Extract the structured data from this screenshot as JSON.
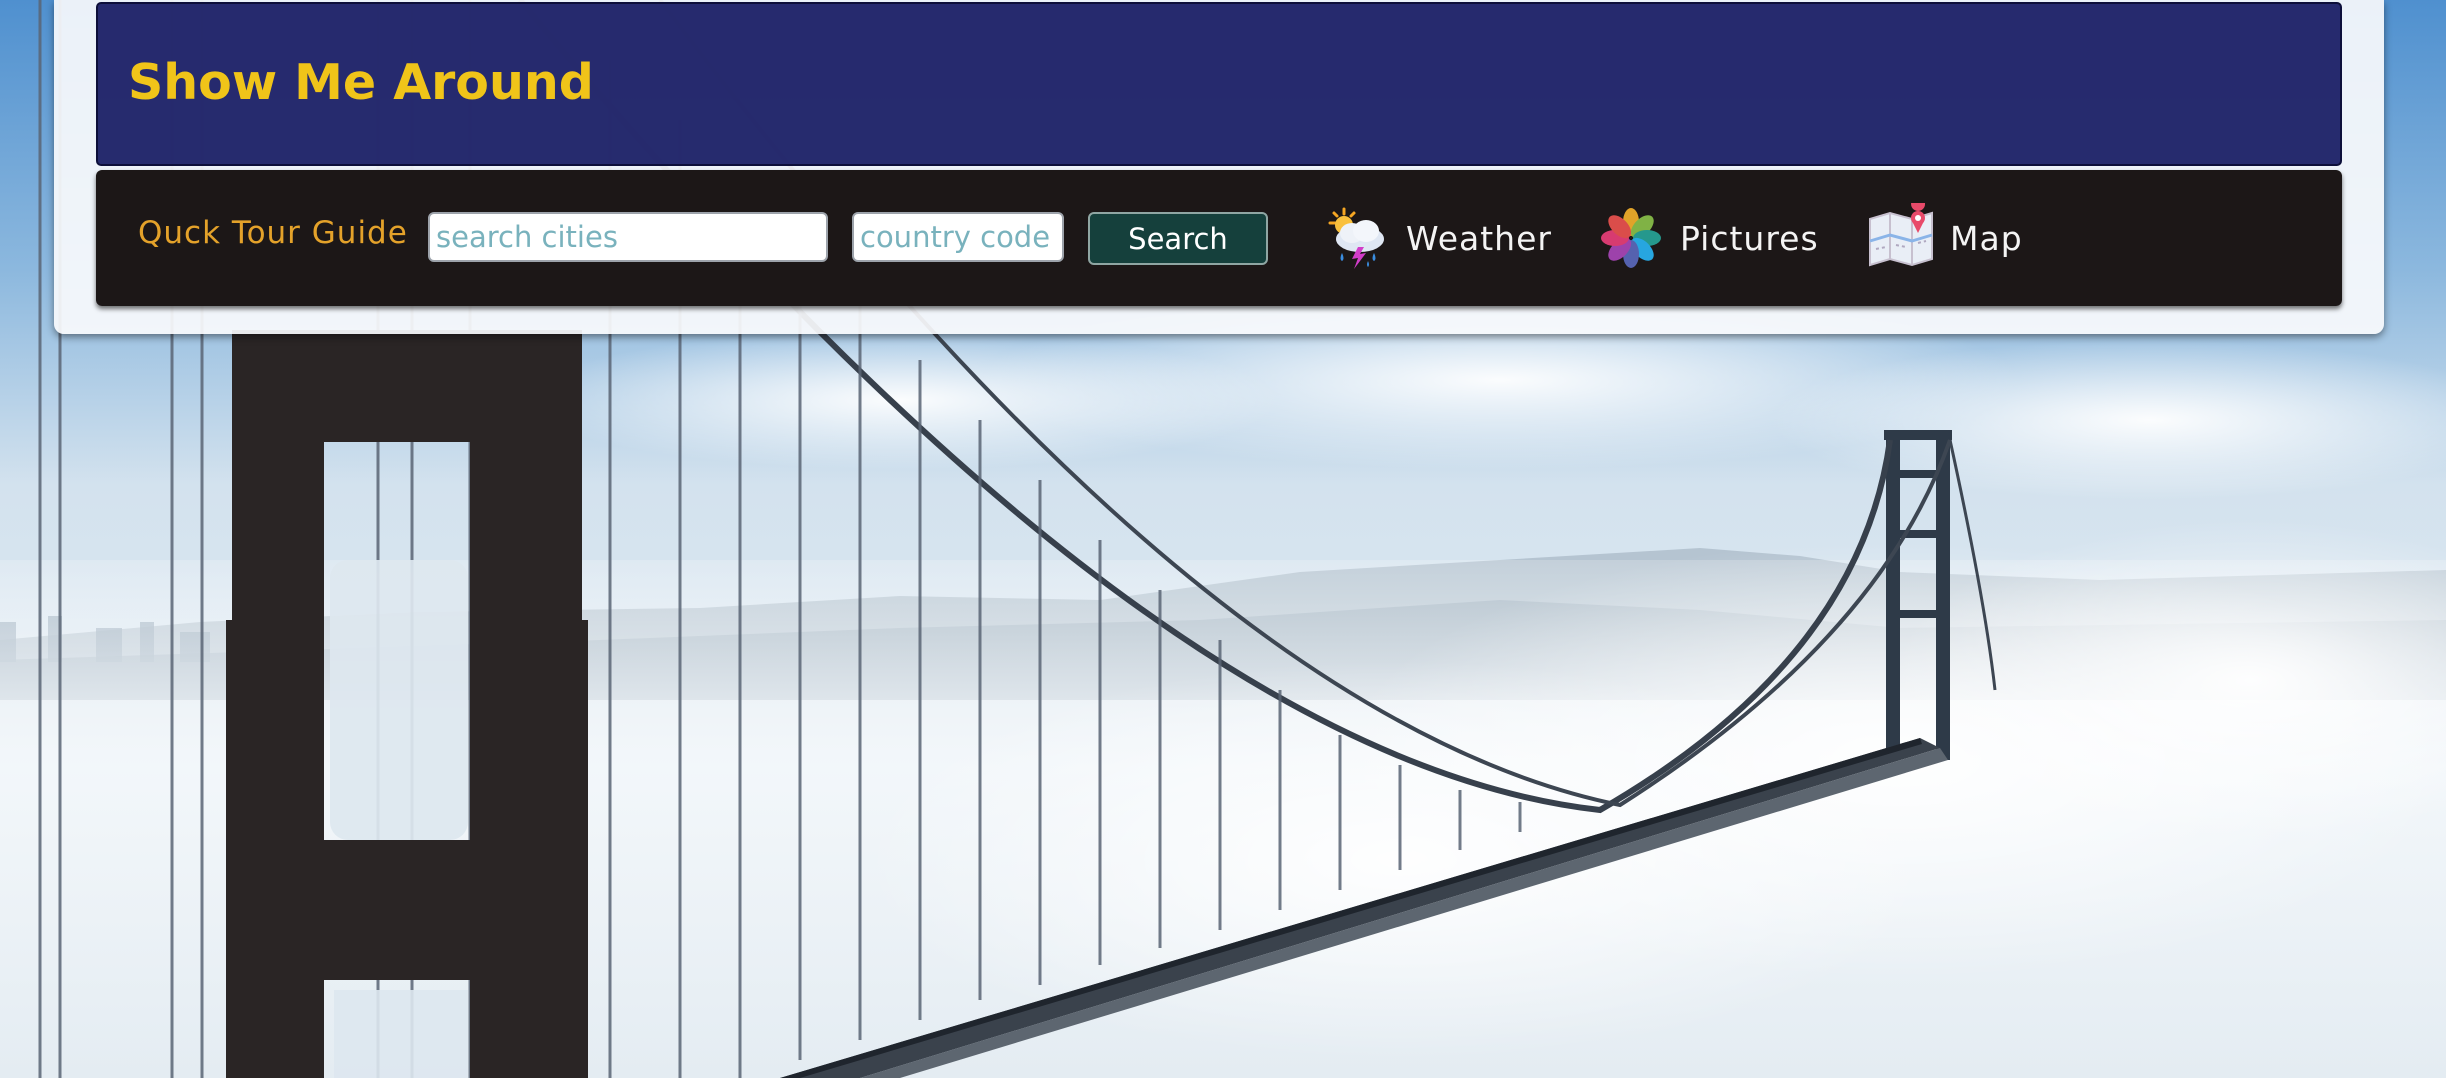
{
  "header": {
    "title": "Show Me Around"
  },
  "nav": {
    "brand": "Quck Tour Guide",
    "city_input": {
      "value": "",
      "placeholder": "search cities"
    },
    "country_input": {
      "value": "",
      "placeholder": "country code"
    },
    "search_label": "Search",
    "links": [
      {
        "label": "Weather",
        "icon": "weather-icon"
      },
      {
        "label": "Pictures",
        "icon": "pictures-icon"
      },
      {
        "label": "Map",
        "icon": "map-icon"
      }
    ]
  },
  "colors": {
    "title_bar": "#1b1f66",
    "title_text": "#f0c419",
    "nav_bar": "#150f0f",
    "brand_text": "#e4a22a",
    "search_button": "#15403c",
    "placeholder_text": "#79b2bd"
  },
  "background": "golden-gate-bridge-in-fog"
}
